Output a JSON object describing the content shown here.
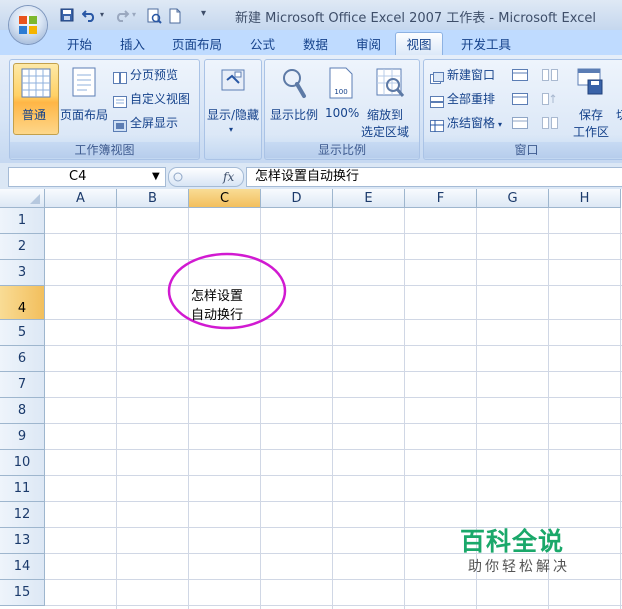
{
  "window": {
    "title": "新建 Microsoft Office Excel 2007 工作表 - Microsoft Excel"
  },
  "tabs": [
    "开始",
    "插入",
    "页面布局",
    "公式",
    "数据",
    "审阅",
    "视图",
    "开发工具"
  ],
  "active_tab": "视图",
  "ribbon": {
    "workbook_views": {
      "label": "工作簿视图",
      "normal": "普通",
      "page_layout": "页面布局",
      "page_break_preview": "分页预览",
      "custom_views": "自定义视图",
      "full_screen": "全屏显示"
    },
    "show_hide": {
      "label": "显示/隐藏"
    },
    "zoom": {
      "label": "显示比例",
      "zoom": "显示比例",
      "hundred": "100%",
      "zoom_to_selection_line1": "缩放到",
      "zoom_to_selection_line2": "选定区域"
    },
    "window": {
      "label": "窗口",
      "new_window": "新建窗口",
      "arrange_all": "全部重排",
      "freeze_panes": "冻结窗格",
      "save_workspace_line1": "保存",
      "save_workspace_line2": "工作区",
      "switch_partial": "切"
    }
  },
  "formula_bar": {
    "name_box": "C4",
    "fx": "fx",
    "content": "怎样设置自动换行"
  },
  "sheet": {
    "columns": [
      "A",
      "B",
      "C",
      "D",
      "E",
      "F",
      "G",
      "H"
    ],
    "rows": [
      "1",
      "2",
      "3",
      "4",
      "5",
      "6",
      "7",
      "8",
      "9",
      "10",
      "11",
      "12",
      "13",
      "14",
      "15"
    ],
    "selected_cell": "C4",
    "cell_line1": "怎样设置",
    "cell_line2": "自动换行",
    "highlight_color": "#d11ad1"
  },
  "watermark": {
    "title": "百科全说",
    "subtitle": "助你轻松解决"
  }
}
